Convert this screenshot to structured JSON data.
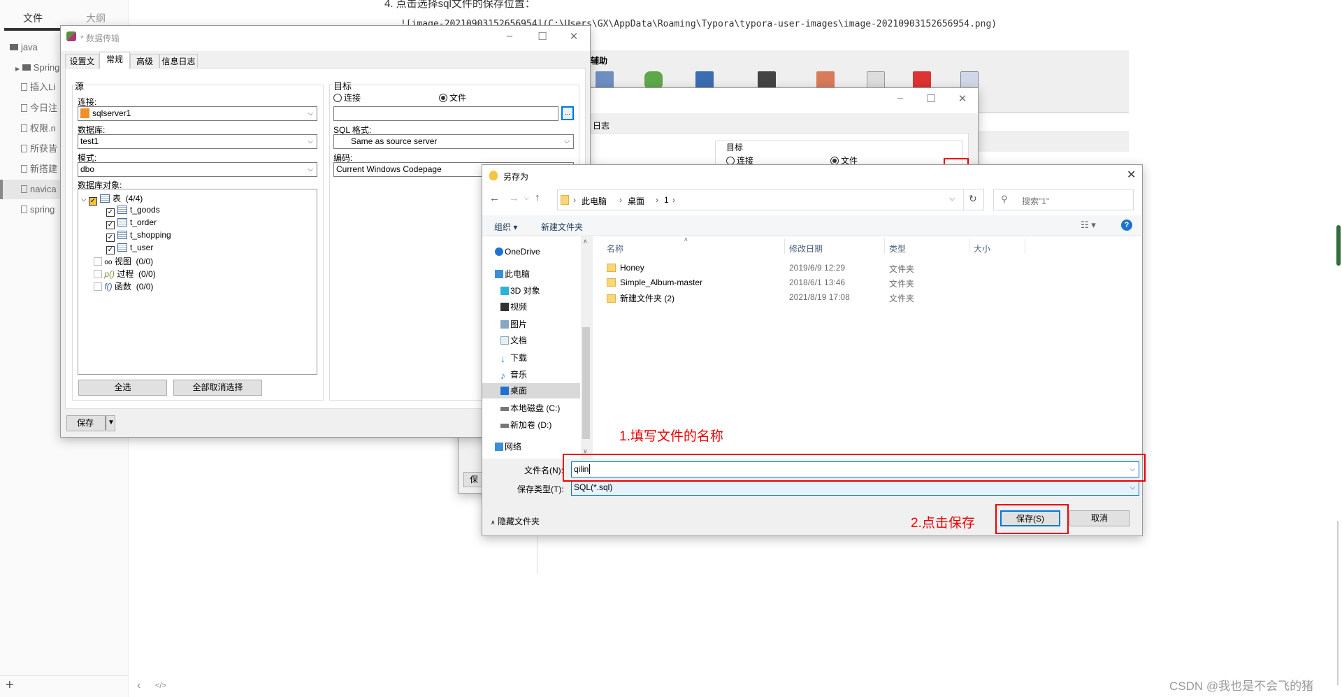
{
  "typora": {
    "tabs": [
      "文件",
      "大纲"
    ],
    "files": [
      {
        "name": "java",
        "type": "folder"
      },
      {
        "name": "Spring",
        "type": "folder"
      },
      {
        "name": "插入Li",
        "type": "file"
      },
      {
        "name": "今日注",
        "type": "file"
      },
      {
        "name": "权限.n",
        "type": "file"
      },
      {
        "name": "所获皆",
        "type": "file"
      },
      {
        "name": "新搭建",
        "type": "file"
      },
      {
        "name": "navica",
        "type": "file",
        "selected": true
      },
      {
        "name": "spring",
        "type": "file"
      }
    ],
    "add_label": "+",
    "heading": "4. 点击选择sql文件的保存位置：",
    "code_line": "![image-20210903152656954](C:\\Users\\GX\\AppData\\Roaming\\Typora\\typora-user-images\\image-20210903152656954.png)",
    "embedded_label": "辅助",
    "bottom_back": "‹",
    "bottom_source": "</>"
  },
  "back_window": {
    "tab_fragment": "日志",
    "target_label": "目标",
    "radio_connect": "连接",
    "radio_file": "文件",
    "save_fragment": "保"
  },
  "transfer": {
    "title": "* 数据传输",
    "tabs": [
      "设置文件",
      "常规",
      "高级",
      "信息日志"
    ],
    "active_tab": "常规",
    "source": {
      "group": "源",
      "connection_label": "连接:",
      "connection": "sqlserver1",
      "database_label": "数据库:",
      "database": "test1",
      "schema_label": "模式:",
      "schema": "dbo",
      "objects_label": "数据库对象:",
      "tree": [
        {
          "label": "表",
          "count": "(4/4)",
          "level": 0,
          "checked": true
        },
        {
          "label": "t_goods",
          "level": 1,
          "checked": true
        },
        {
          "label": "t_order",
          "level": 1,
          "checked": true
        },
        {
          "label": "t_shopping",
          "level": 1,
          "checked": true
        },
        {
          "label": "t_user",
          "level": 1,
          "checked": true
        },
        {
          "label": "视图",
          "count": "(0/0)",
          "level": 0,
          "checked": false
        },
        {
          "label": "过程",
          "count": "(0/0)",
          "level": 0,
          "checked": false
        },
        {
          "label": "函数",
          "count": "(0/0)",
          "level": 0,
          "checked": false
        }
      ],
      "select_all": "全选",
      "deselect_all": "全部取消选择"
    },
    "target": {
      "group": "目标",
      "radio_connect": "连接",
      "radio_file": "文件",
      "selected": "文件",
      "file_value": "",
      "browse": "...",
      "sql_format_label": "SQL 格式:",
      "sql_format": "Same as source server",
      "encoding_label": "编码:",
      "encoding": "Current Windows Codepage"
    },
    "save_button": "保存"
  },
  "save_as": {
    "title": "另存为",
    "breadcrumb": [
      "此电脑",
      "桌面",
      "1"
    ],
    "search_placeholder": "搜索\"1\"",
    "organize": "组织 ▾",
    "new_folder": "新建文件夹",
    "nav": [
      {
        "label": "OneDrive",
        "icon": "cloud-icon"
      },
      {
        "label": "此电脑",
        "icon": "computer-icon"
      },
      {
        "label": "3D 对象",
        "icon": "cube-icon"
      },
      {
        "label": "视频",
        "icon": "video-icon"
      },
      {
        "label": "图片",
        "icon": "picture-icon"
      },
      {
        "label": "文档",
        "icon": "document-icon"
      },
      {
        "label": "下载",
        "icon": "download-icon"
      },
      {
        "label": "音乐",
        "icon": "music-icon"
      },
      {
        "label": "桌面",
        "icon": "desktop-icon",
        "selected": true
      },
      {
        "label": "本地磁盘 (C:)",
        "icon": "drive-icon"
      },
      {
        "label": "新加卷 (D:)",
        "icon": "drive-icon"
      },
      {
        "label": "网络",
        "icon": "network-icon"
      }
    ],
    "columns": [
      "名称",
      "修改日期",
      "类型",
      "大小"
    ],
    "files": [
      {
        "name": "Honey",
        "date": "2019/6/9 12:29",
        "type": "文件夹"
      },
      {
        "name": "Simple_Album-master",
        "date": "2018/6/1 13:46",
        "type": "文件夹"
      },
      {
        "name": "新建文件夹 (2)",
        "date": "2021/8/19 17:08",
        "type": "文件夹"
      }
    ],
    "filename_label": "文件名(N):",
    "filename": "qilin",
    "filetype_label": "保存类型(T):",
    "filetype": "SQL(*.sql)",
    "hide_folders": "隐藏文件夹",
    "save": "保存(S)",
    "cancel": "取消"
  },
  "annotations": {
    "step1": "1.填写文件的名称",
    "step2": "2.点击保存",
    "color": "#e00000"
  },
  "watermark": "CSDN @我也是不会飞的猪"
}
